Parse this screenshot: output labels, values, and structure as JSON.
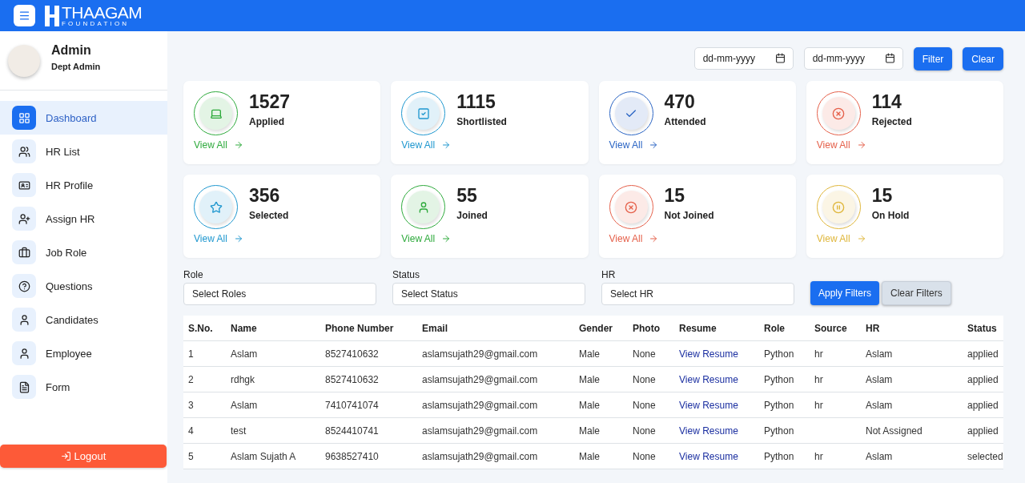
{
  "header": {
    "logo_title": "THAAGAM",
    "logo_subtitle": "FOUNDATION"
  },
  "profile": {
    "name": "Admin",
    "role": "Dept Admin"
  },
  "sidebar": {
    "items": [
      {
        "label": "Dashboard",
        "selected": true
      },
      {
        "label": "HR List",
        "selected": false
      },
      {
        "label": "HR Profile",
        "selected": false
      },
      {
        "label": "Assign HR",
        "selected": false
      },
      {
        "label": "Job Role",
        "selected": false
      },
      {
        "label": "Questions",
        "selected": false
      },
      {
        "label": "Candidates",
        "selected": false
      },
      {
        "label": "Employee",
        "selected": false
      },
      {
        "label": "Form",
        "selected": false
      }
    ],
    "logout": "Logout"
  },
  "date_filter": {
    "from_placeholder": "dd-mm-yyyy",
    "to_placeholder": "dd-mm-yyyy",
    "buttons": [
      "Filter",
      "Clear"
    ]
  },
  "stats": [
    {
      "count": "1527",
      "label": "Applied",
      "link": "View All",
      "color": "#2eaa3c"
    },
    {
      "count": "1115",
      "label": "Shortlisted",
      "link": "View All",
      "color": "#1e97cf"
    },
    {
      "count": "470",
      "label": "Attended",
      "link": "View All",
      "color": "#2b65c4"
    },
    {
      "count": "114",
      "label": "Rejected",
      "link": "View All",
      "color": "#e5604a"
    },
    {
      "count": "356",
      "label": "Selected",
      "link": "View All",
      "color": "#1e97cf"
    },
    {
      "count": "55",
      "label": "Joined",
      "link": "View All",
      "color": "#2eaa3c"
    },
    {
      "count": "15",
      "label": "Not Joined",
      "link": "View All",
      "color": "#e5604a"
    },
    {
      "count": "15",
      "label": "On Hold",
      "link": "View All",
      "color": "#dfb63a"
    }
  ],
  "filters": {
    "fields": [
      {
        "label": "Role",
        "placeholder": "Select Roles"
      },
      {
        "label": "Status",
        "placeholder": "Select Status"
      },
      {
        "label": "HR",
        "placeholder": "Select HR"
      }
    ],
    "apply": "Apply Filters",
    "clear": "Clear Filters"
  },
  "table": {
    "columns": [
      "S.No.",
      "Name",
      "Phone Number",
      "Email",
      "Gender",
      "Photo",
      "Resume",
      "Role",
      "Source",
      "HR",
      "Status"
    ],
    "rows": [
      {
        "cells": [
          "1",
          "Aslam",
          "8527410632",
          "aslamsujath29@gmail.com",
          "Male",
          "None",
          "View Resume",
          "Python",
          "hr",
          "Aslam",
          "applied"
        ]
      },
      {
        "cells": [
          "2",
          "rdhgk",
          "8527410632",
          "aslamsujath29@gmail.com",
          "Male",
          "None",
          "View Resume",
          "Python",
          "hr",
          "Aslam",
          "applied"
        ]
      },
      {
        "cells": [
          "3",
          "Aslam",
          "7410741074",
          "aslamsujath29@gmail.com",
          "Male",
          "None",
          "View Resume",
          "Python",
          "hr",
          "Aslam",
          "applied"
        ]
      },
      {
        "cells": [
          "4",
          "test",
          "8524410741",
          "aslamsujath29@gmail.com",
          "Male",
          "None",
          "View Resume",
          "Python",
          "",
          "Not Assigned",
          "applied"
        ]
      },
      {
        "cells": [
          "5",
          "Aslam Sujath A",
          "9638527410",
          "aslamsujath29@gmail.com",
          "Male",
          "None",
          "View Resume",
          "Python",
          "hr",
          "Aslam",
          "selected"
        ]
      }
    ]
  }
}
